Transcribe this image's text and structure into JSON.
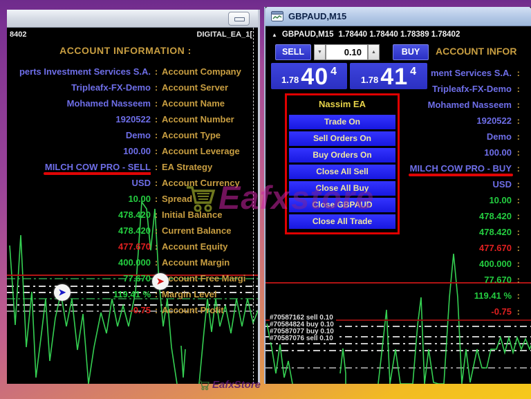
{
  "colors": {
    "value_blue": "#6e6ee8",
    "label_gold": "#c89e41",
    "profit_green": "#24cd40",
    "loss_red": "#e02020",
    "ea_button_blue": "#2222f0",
    "ea_panel_border_red": "#e00000",
    "trade_button_blue": "#3a40d8",
    "chart_line_green": "#35d052",
    "stop_line_red": "#b01414"
  },
  "icons": {
    "collapse_arrow": "▲",
    "spin_up": "▲",
    "spin_down": "▼",
    "marker_arrow": "➤"
  },
  "watermark": {
    "brand_left": "Eafx",
    "brand_right": "store",
    "bottom_text": "EafxStore"
  },
  "left_window": {
    "quote_fragment": "8402",
    "ea_id": "DIGITAL_EA_1[",
    "section_title": "ACCOUNT INFORMATION :",
    "rows": [
      {
        "value": "perts Investment Services S.A.",
        "label": "Account Company",
        "c": "blue"
      },
      {
        "value": "Tripleafx-FX-Demo",
        "label": "Account Server",
        "c": "blue"
      },
      {
        "value": "Mohamed Nasseem",
        "label": "Account Name",
        "c": "blue"
      },
      {
        "value": "1920522",
        "label": "Account Number",
        "c": "blue"
      },
      {
        "value": "Demo",
        "label": "Account Type",
        "c": "blue"
      },
      {
        "value": "100.00",
        "label": "Account Leverage",
        "c": "blue"
      },
      {
        "value": "MILCH COW PRO - SELL",
        "label": "EA Strategy",
        "c": "blue",
        "cls": "ul-red"
      },
      {
        "value": "USD",
        "label": "Account Currency",
        "c": "blue"
      },
      {
        "value": "10.00",
        "label": "Spread",
        "c": "green"
      },
      {
        "value": "478.420",
        "label": "Initial  Balance",
        "c": "green"
      },
      {
        "value": "478.420",
        "label": "Current Balance",
        "c": "green"
      },
      {
        "value": "477.670",
        "label": "Account Equity",
        "c": "red"
      },
      {
        "value": "400.000",
        "label": "Account Margin",
        "c": "green"
      },
      {
        "value": "77.670",
        "label": "Account Free Margi",
        "c": "green"
      },
      {
        "value": "119.41 %",
        "label": "Margin Level",
        "c": "green"
      },
      {
        "value": "-0.75",
        "label": "Account Profit",
        "c": "red"
      }
    ]
  },
  "right_window": {
    "title": "GBPAUD,M15",
    "quote": {
      "symbol": "GBPAUD,M15",
      "ohlc": "1.78440 1.78440 1.78389 1.78402"
    },
    "trade_panel": {
      "sell_label": "SELL",
      "buy_label": "BUY",
      "volume": "0.10",
      "sell_price_prefix": "1.78",
      "sell_price_big": "40",
      "sell_price_sup": "4",
      "buy_price_prefix": "1.78",
      "buy_price_big": "41",
      "buy_price_sup": "4"
    },
    "section_title": "ACCOUNT INFOR",
    "rows": [
      {
        "value": "ment Services S.A.",
        "c": "blue"
      },
      {
        "value": "Tripleafx-FX-Demo",
        "c": "blue"
      },
      {
        "value": "Mohamed Nasseem",
        "c": "blue"
      },
      {
        "value": "1920522",
        "c": "blue"
      },
      {
        "value": "Demo",
        "c": "blue"
      },
      {
        "value": "100.00",
        "c": "blue"
      },
      {
        "value": "MILCH COW PRO - BUY",
        "c": "blue",
        "cls": "ul-red"
      },
      {
        "value": "USD",
        "c": "blue"
      },
      {
        "value": "10.00",
        "c": "green"
      },
      {
        "value": "478.420",
        "c": "green"
      },
      {
        "value": "478.420",
        "c": "green"
      },
      {
        "value": "477.670",
        "c": "red"
      },
      {
        "value": "400.000",
        "c": "green"
      },
      {
        "value": "77.670",
        "c": "green"
      },
      {
        "value": "119.41 %",
        "c": "green"
      },
      {
        "value": "-0.75",
        "c": "red"
      }
    ],
    "ea_panel": {
      "title": "Nassim EA",
      "buttons": [
        "Trade On",
        "Sell Orders On",
        "Buy Orders On",
        "Close All Sell",
        "Close All Buy",
        "Close GBPAUD",
        "Close All Trade"
      ]
    },
    "trades": [
      "#70587162 sell 0.10",
      "#70584824 buy 0.10",
      "#70587077 buy 0.10",
      "#70587076 sell 0.10"
    ]
  }
}
